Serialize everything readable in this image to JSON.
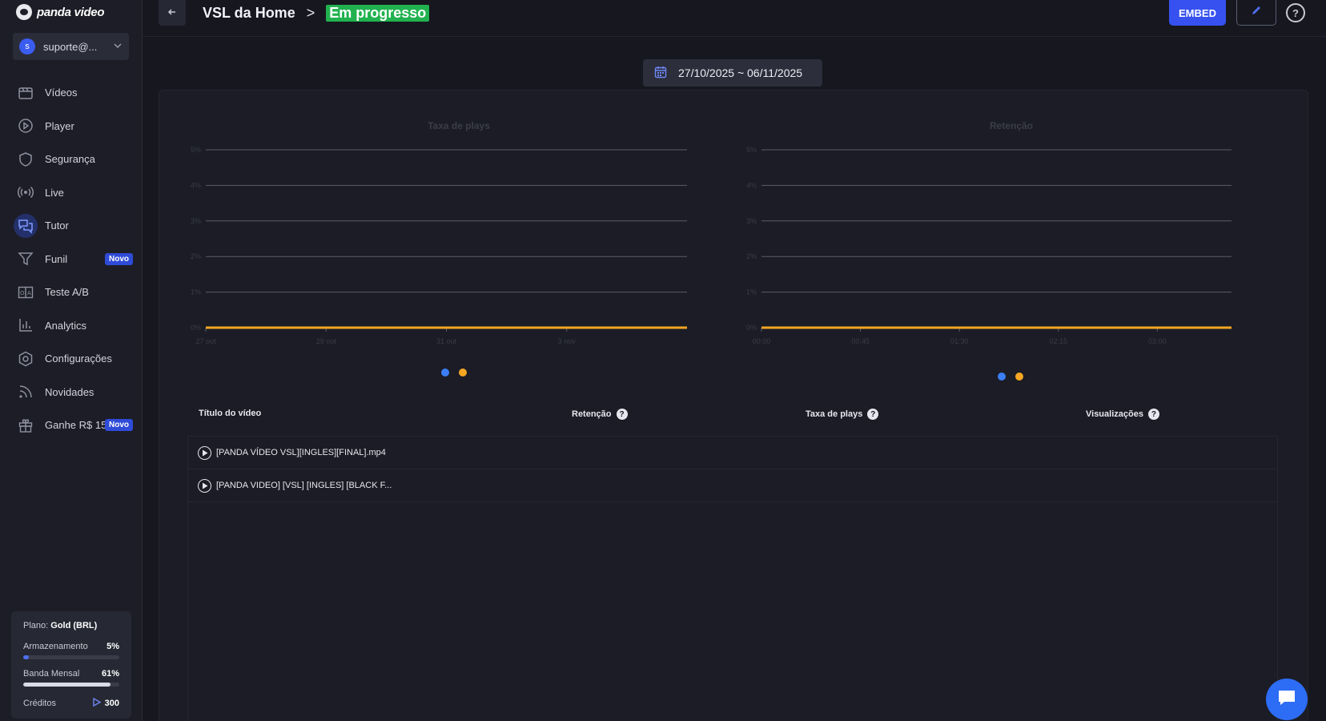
{
  "app": {
    "logo_text": "panda video"
  },
  "user": {
    "avatar_letter": "s",
    "name": "suporte@..."
  },
  "nav": [
    {
      "label": "Vídeos",
      "icon": "film-icon"
    },
    {
      "label": "Player",
      "icon": "play-circle-icon"
    },
    {
      "label": "Segurança",
      "icon": "shield-icon"
    },
    {
      "label": "Live",
      "icon": "broadcast-icon"
    },
    {
      "label": "Tutor",
      "icon": "chat-bubbles-icon",
      "active": true
    },
    {
      "label": "Funil",
      "icon": "funnel-icon",
      "badge": "Novo"
    },
    {
      "label": "Teste A/B",
      "icon": "ab-test-icon"
    },
    {
      "label": "Analytics",
      "icon": "bar-chart-icon"
    },
    {
      "label": "Configurações",
      "icon": "gear-icon"
    },
    {
      "label": "Novidades",
      "icon": "rss-icon"
    },
    {
      "label": "Ganhe R$ 150",
      "icon": "gift-icon",
      "badge": "Novo"
    }
  ],
  "plan": {
    "plan_label": "Plano:",
    "plan_name": "Gold (BRL)",
    "storage_label": "Armazenamento",
    "storage_pct": "5%",
    "storage_fraction": 0.05,
    "bandwidth_label": "Banda Mensal",
    "bandwidth_pct": "61%",
    "bandwidth_fraction": 0.61,
    "credits_label": "Créditos",
    "credits_value": "300"
  },
  "header": {
    "title": "VSL da Home",
    "separator": ">",
    "status": "Em progresso",
    "embed_label": "EMBED",
    "help": "?"
  },
  "date_range": "27/10/2025 ~ 06/11/2025",
  "chart_data": [
    {
      "type": "line",
      "title": "Taxa de plays",
      "y_ticks": [
        "5%",
        "4%",
        "3%",
        "2%",
        "1%",
        "0%"
      ],
      "ylim": [
        0,
        5
      ],
      "x_ticks": [
        "27 out",
        "29 out",
        "31 out",
        "3 nov"
      ],
      "grid": true,
      "legend": "bottom",
      "series": [
        {
          "color": "#3b7ef6",
          "values": [
            0,
            0,
            0,
            0
          ]
        },
        {
          "color": "#f5a623",
          "values": [
            0,
            0,
            0,
            0
          ]
        }
      ]
    },
    {
      "type": "line",
      "title": "Retenção",
      "y_ticks": [
        "5%",
        "4%",
        "3%",
        "2%",
        "1%",
        "0%"
      ],
      "ylim": [
        0,
        5
      ],
      "x_ticks": [
        "00:00",
        "00:45",
        "01:30",
        "02:15",
        "03:00"
      ],
      "grid": true,
      "legend": "bottom",
      "series": [
        {
          "color": "#3b7ef6",
          "values": [
            0,
            0,
            0,
            0,
            0
          ]
        },
        {
          "color": "#f5a623",
          "values": [
            0,
            0,
            0,
            0,
            0
          ]
        }
      ]
    }
  ],
  "table": {
    "columns": [
      "Título do vídeo",
      "Retenção",
      "Taxa de plays",
      "Visualizações"
    ],
    "rows": [
      {
        "title": "[PANDA VÍDEO VSL][INGLES][FINAL].mp4"
      },
      {
        "title": "[PANDA VIDEO] [VSL] [INGLES] [BLACK F..."
      }
    ]
  }
}
